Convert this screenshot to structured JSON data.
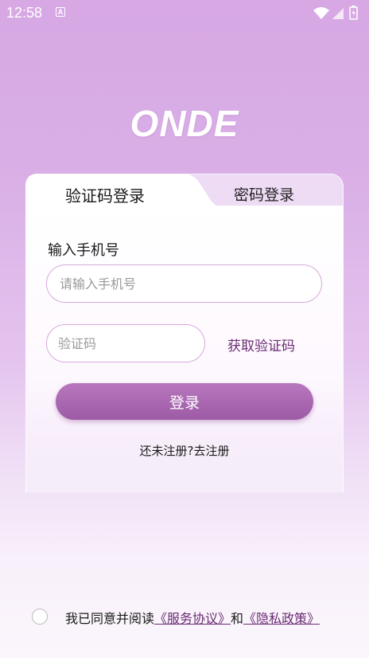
{
  "status_bar": {
    "time": "12:58",
    "icons": [
      "a-notification-icon",
      "wifi-icon",
      "signal-icon",
      "battery-icon"
    ]
  },
  "brand": {
    "logo_text": "ONDE"
  },
  "tabs": [
    {
      "label": "验证码登录",
      "active": true
    },
    {
      "label": "密码登录",
      "active": false
    }
  ],
  "form": {
    "phone_label": "输入手机号",
    "phone_placeholder": "请输入手机号",
    "code_placeholder": "验证码",
    "get_code_label": "获取验证码",
    "login_label": "登录"
  },
  "register": {
    "prompt": "还未注册?",
    "link": "去注册"
  },
  "agreement": {
    "prefix": "我已同意并阅读",
    "service": "《服务协议》",
    "and": "和",
    "privacy": "《隐私政策》",
    "checked": false
  },
  "colors": {
    "accent": "#a35fab",
    "link": "#6a2c74",
    "border": "#d9a8de"
  }
}
